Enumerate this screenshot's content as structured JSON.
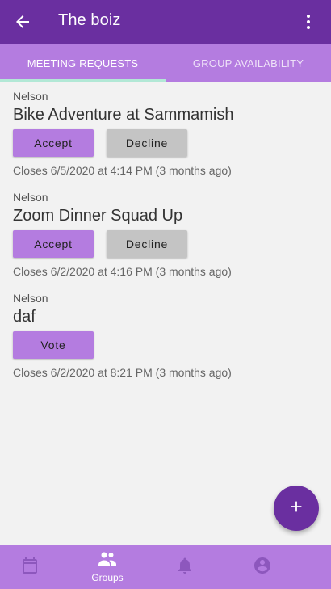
{
  "appbar": {
    "title": "The boiz",
    "back_icon": "arrow-left-icon",
    "more_icon": "more-vertical-icon",
    "color": "#6a2fa0"
  },
  "tabs": [
    {
      "label": "MEETING REQUESTS",
      "active": true
    },
    {
      "label": "GROUP AVAILABILITY",
      "active": false
    }
  ],
  "meetings": [
    {
      "owner": "Nelson",
      "title": "Bike Adventure at Sammamish",
      "accept_label": "Accept",
      "decline_label": "Decline",
      "closes": "Closes 6/5/2020 at 4:14 PM (3 months ago)"
    },
    {
      "owner": "Nelson",
      "title": "Zoom Dinner Squad Up",
      "accept_label": "Accept",
      "decline_label": "Decline",
      "closes": "Closes 6/2/2020 at 4:16 PM (3 months ago)"
    },
    {
      "owner": "Nelson",
      "title": "daf",
      "vote_label": "Vote",
      "closes": "Closes 6/2/2020 at 8:21 PM (3 months ago)"
    }
  ],
  "fab": {
    "icon": "plus-icon"
  },
  "bottom_nav": {
    "items": [
      {
        "icon": "calendar-icon",
        "label": ""
      },
      {
        "icon": "groups-icon",
        "label": "Groups",
        "active": true
      },
      {
        "icon": "bell-icon",
        "label": ""
      },
      {
        "icon": "account-icon",
        "label": ""
      }
    ]
  },
  "colors": {
    "primary": "#6a2fa0",
    "accent": "#b47ce0",
    "indicator": "#b2e8d6",
    "decline": "#c4c4c4"
  }
}
